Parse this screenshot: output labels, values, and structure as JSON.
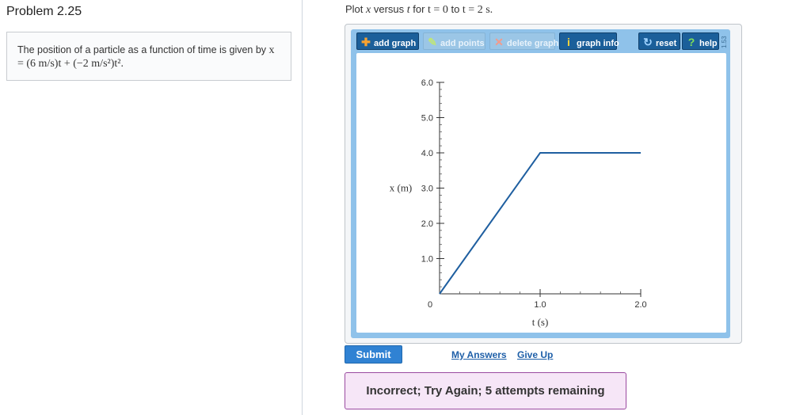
{
  "problem": {
    "title": "Problem 2.25",
    "statement_text": "The position of a particle as a function of time is given by ",
    "statement_eq": "x = (6 m/s)t + (−2 m/s²)t²."
  },
  "instruction": {
    "prefix": "Plot ",
    "var1": "x",
    "mid1": " versus ",
    "var2": "t",
    "mid2": " for ",
    "cond1": "t = 0",
    "mid3": " to ",
    "cond2": "t = 2 s."
  },
  "toolbar": {
    "add_graph": "add graph",
    "add_points": "add points",
    "delete_graph": "delete graph",
    "graph_info": "graph info",
    "reset": "reset",
    "help": "help",
    "version": "1.53"
  },
  "icons": {
    "add_graph": "plus-icon",
    "add_points": "pencil-icon",
    "delete_graph": "x-icon",
    "graph_info": "info-icon",
    "reset": "reset-icon",
    "help": "question-icon"
  },
  "chart_data": {
    "type": "line",
    "xlabel": "t (s)",
    "ylabel": "x (m)",
    "xlim": [
      0,
      2
    ],
    "ylim": [
      0,
      6
    ],
    "x_ticks": [
      {
        "value": 1.0,
        "label": "1.0"
      },
      {
        "value": 2.0,
        "label": "2.0"
      }
    ],
    "y_ticks": [
      {
        "value": 1.0,
        "label": "1.0"
      },
      {
        "value": 2.0,
        "label": "2.0"
      },
      {
        "value": 3.0,
        "label": "3.0"
      },
      {
        "value": 4.0,
        "label": "4.0"
      },
      {
        "value": 5.0,
        "label": "5.0"
      },
      {
        "value": 6.0,
        "label": "6.0"
      }
    ],
    "origin_label": "0",
    "series": [
      {
        "x": [
          0,
          1,
          2
        ],
        "y": [
          0,
          4,
          4
        ]
      }
    ],
    "line_color": "#1f5fa0"
  },
  "actions": {
    "submit": "Submit",
    "my_answers": "My Answers",
    "give_up": "Give Up"
  },
  "feedback": "Incorrect; Try Again; 5 attempts remaining"
}
